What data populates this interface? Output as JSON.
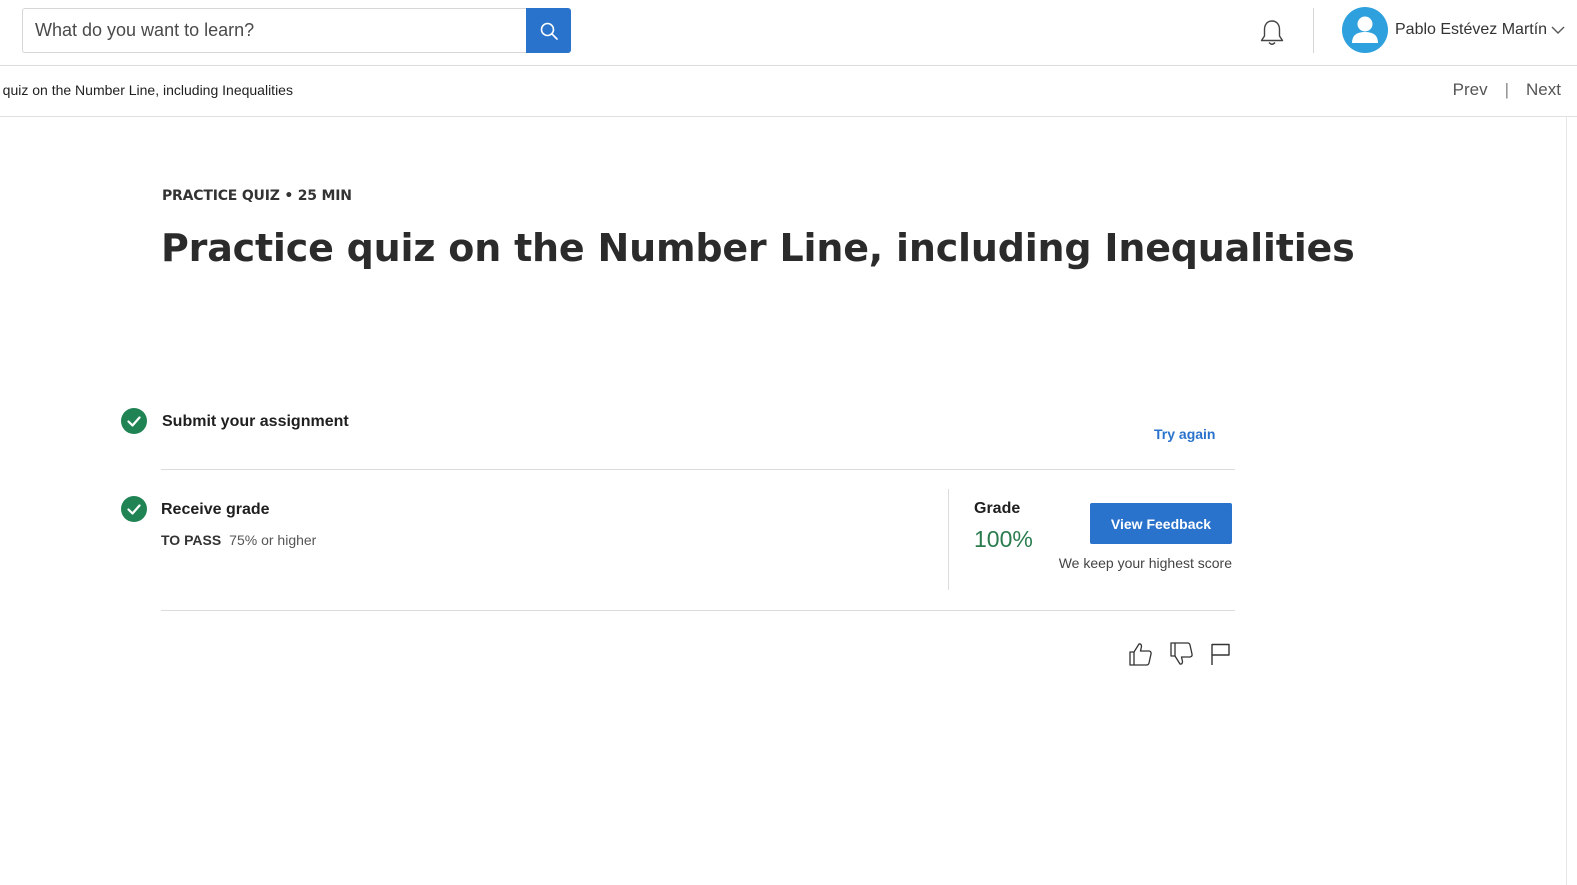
{
  "header": {
    "search": {
      "placeholder": "What do you want to learn?"
    },
    "user": {
      "name": "Pablo Estévez Martín"
    }
  },
  "subheader": {
    "breadcrumb": "e quiz on the Number Line, including Inequalities",
    "prev_label": "Prev",
    "separator": "|",
    "next_label": "Next"
  },
  "main": {
    "meta": "PRACTICE QUIZ • 25 MIN",
    "title": "Practice quiz on the Number Line, including Inequalities",
    "steps": [
      {
        "label": "Submit your assignment",
        "action_label": "Try again"
      },
      {
        "label": "Receive grade",
        "to_pass_key": "TO PASS",
        "to_pass_value": "75% or higher"
      }
    ],
    "grade": {
      "label": "Grade",
      "value": "100%",
      "button_label": "View Feedback",
      "note": "We keep your highest score"
    }
  },
  "colors": {
    "accent": "#2a73cc",
    "success": "#1f8354",
    "grade": "#2a7c4f"
  },
  "icons": [
    "search-icon",
    "bell-icon",
    "avatar-icon",
    "chevron-down-icon",
    "check-circle-icon",
    "thumbs-up-icon",
    "thumbs-down-icon",
    "flag-icon"
  ]
}
